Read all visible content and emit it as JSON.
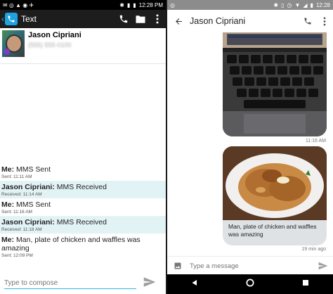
{
  "left": {
    "status": {
      "time": "12:28 PM"
    },
    "appbar": {
      "title": "Text"
    },
    "contact": {
      "name": "Jason Cipriani",
      "number": "(555) 555-0100"
    },
    "messages": [
      {
        "sender": "Me:",
        "body": "MMS Sent",
        "meta": "Sent: 11:11 AM",
        "incoming": false
      },
      {
        "sender": "Jason Cipriani:",
        "body": "MMS Received",
        "meta": "Received: 11:14 AM",
        "incoming": true
      },
      {
        "sender": "Me:",
        "body": "MMS Sent",
        "meta": "Sent: 11:16 AM",
        "incoming": false
      },
      {
        "sender": "Jason Cipriani:",
        "body": "MMS Received",
        "meta": "Received: 11:18 AM",
        "incoming": true
      },
      {
        "sender": "Me:",
        "body": "Man, plate of chicken and waffles was amazing",
        "meta": "Sent: 12:09 PM",
        "incoming": false
      }
    ],
    "compose": {
      "placeholder": "Type to compose"
    }
  },
  "right": {
    "status": {
      "time": "12:28"
    },
    "appbar": {
      "title": "Jason Cipriani"
    },
    "messages": [
      {
        "type": "image",
        "time": "11:16 AM"
      },
      {
        "type": "image-caption",
        "caption": "Man, plate of chicken and waffles was amazing",
        "time": "19 min ago"
      }
    ],
    "compose": {
      "placeholder": "Type a message"
    }
  },
  "colors": {
    "accent_left": "#33b5e5",
    "incoming_bg": "#e2f3f6",
    "right_status": "#8c8c8c",
    "bubble_bg": "#dfe2e5"
  }
}
